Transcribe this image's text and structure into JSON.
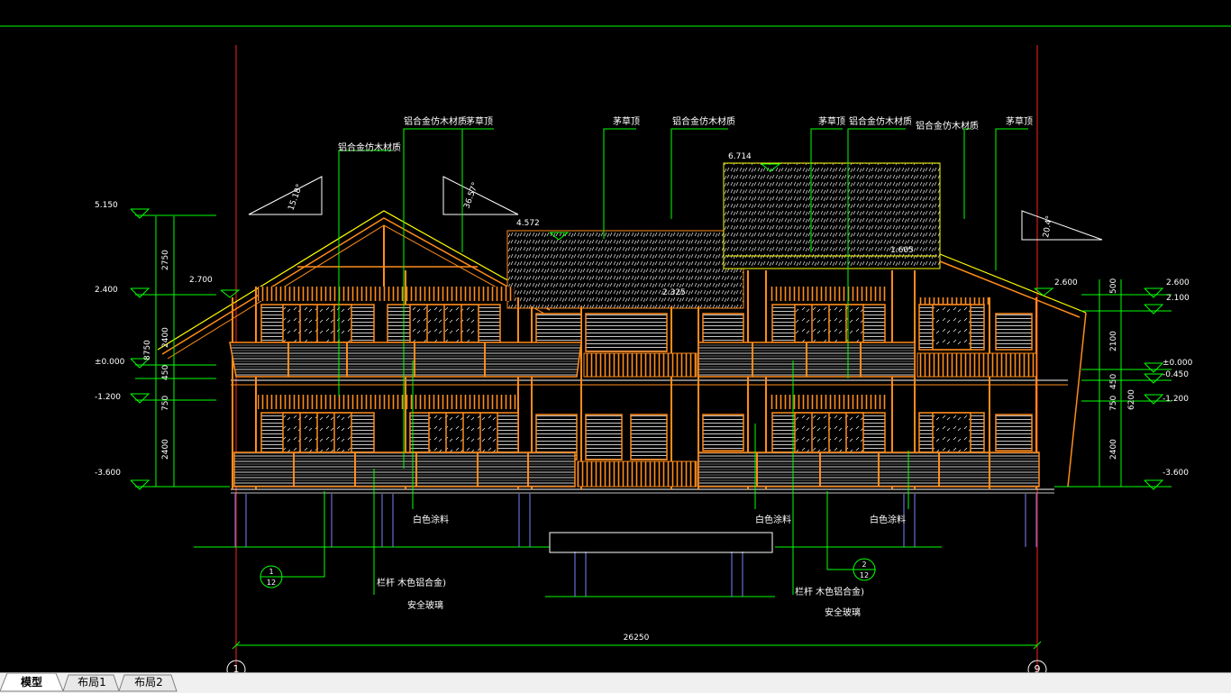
{
  "drawing": {
    "elevation_labels": {
      "lv_5150": "5.150",
      "lv_2400": "2.400",
      "lv_2700": "2.700",
      "lv_0000_left": "±0.000",
      "lv_m1200_left": "-1.200",
      "lv_m3600_left": "-3.600",
      "lv_4572": "4.572",
      "lv_6714": "6.714",
      "lv_2600_a": "2.600",
      "lv_2600_b": "2.600",
      "lv_2100": "2.100",
      "lv_0000_right": "±0.000",
      "lv_m0450": "-0.450",
      "lv_m1200_right": "-1.200",
      "lv_m3600_right": "-3.600",
      "lv_2325": "2.325",
      "lv_1605": "1.605"
    },
    "dimension_labels": {
      "left_2750": "2750",
      "left_2400a": "2400",
      "left_450": "450",
      "left_750": "750",
      "left_2400b": "2400",
      "left_8750": "8750",
      "right_500": "500",
      "right_2100": "2100",
      "right_450": "450",
      "right_750": "750",
      "right_2400": "2400",
      "right_6200": "6200",
      "overall_width": "26250"
    },
    "slope_labels": {
      "slope_1": "15.18°",
      "slope_2": "36.57°",
      "slope_3": "20.4°"
    },
    "annotations": {
      "alu_wood_1": "铝合金仿木材质",
      "alu_wood_2": "铝合金仿木材质",
      "thatch_1": "茅草顶",
      "thatch_2": "茅草顶",
      "alu_wood_3": "铝合金仿木材质",
      "thatch_3": "茅草顶",
      "alu_wood_4": "铝合金仿木材质",
      "alu_wood_5": "铝合金仿木材质",
      "thatch_4": "茅草顶",
      "white_paint_1": "白色涂料",
      "white_paint_2": "白色涂料",
      "white_paint_3": "白色涂料",
      "railing_1": "栏杆 木色铝合金)",
      "glass_1": "安全玻璃",
      "railing_2": "栏杆 木色铝合金)",
      "glass_2": "安全玻璃"
    },
    "detail_callouts": {
      "d1_top": "1",
      "d1_bottom": "12",
      "d2_top": "2",
      "d2_bottom": "12"
    },
    "axis_bubbles": {
      "left": "1",
      "right": "9"
    }
  },
  "layout_tabs": [
    {
      "label": "模型",
      "active": true
    },
    {
      "label": "布局1",
      "active": false
    },
    {
      "label": "布局2",
      "active": false
    }
  ],
  "colors": {
    "background": "#000000",
    "line_green": "#00ff00",
    "axis_red": "#ff2020",
    "wood_orange": "#ff8c1a",
    "roof_yellow": "#ffff00",
    "window_white": "#ffffff",
    "column_blue": "#8080ff",
    "text_white": "#ffffff"
  }
}
